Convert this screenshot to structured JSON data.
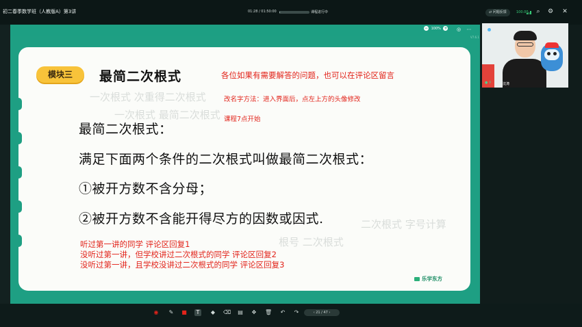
{
  "topbar": {
    "title": "初二春季数学班（人教版A）第3讲",
    "elapsed": "01:28",
    "total": "01:50:00",
    "time_display": "01:28 / 01:50:00",
    "progress_fraction": 0.013,
    "status": "课程进行中",
    "report_label": "问题反馈",
    "network_label": "100.00"
  },
  "stage": {
    "zoom_label": "100%",
    "version": "V7.6.1"
  },
  "slide": {
    "module_label": "模块三",
    "module_title": "最简二次根式",
    "ghost_lines": [
      "一次根式  次重得二次根式",
      "一次根式 最简二次根式",
      "二次根式 字号计算",
      "根号 二次根式"
    ],
    "notes": [
      "各位如果有需要解答的问题，也可以在评论区留言",
      "改名字方法：进入界面后，点左上方的头像修改",
      "课程7点开始"
    ],
    "content": [
      "最简二次根式：",
      "满足下面两个条件的二次根式叫做最简二次根式：",
      "①被开方数不含分母；",
      "②被开方数不含能开得尽方的因数或因式."
    ],
    "replies": [
      "听过第一讲的同学 评论区回复1",
      "没听过第一讲，但学校讲过二次根式的同学  评论区回复2",
      "没听过第一讲，且学校没讲过二次根式的同学  评论区回复3"
    ],
    "brand": "乐学东方"
  },
  "toolbar": {
    "page_indicator": "21 / 47",
    "icons": [
      "record-icon",
      "pen-icon",
      "color-swatch-icon",
      "text-tool-icon",
      "shape-icon",
      "eraser-icon",
      "save-icon",
      "move-icon",
      "delete-icon",
      "undo-icon",
      "redo-icon"
    ]
  },
  "camera": {
    "name": "沈涛"
  },
  "colors": {
    "accent_green": "#1e9f83",
    "note_red": "#e2241b",
    "pill_yellow": "#f8c33a",
    "topbar": "#0c1716"
  }
}
